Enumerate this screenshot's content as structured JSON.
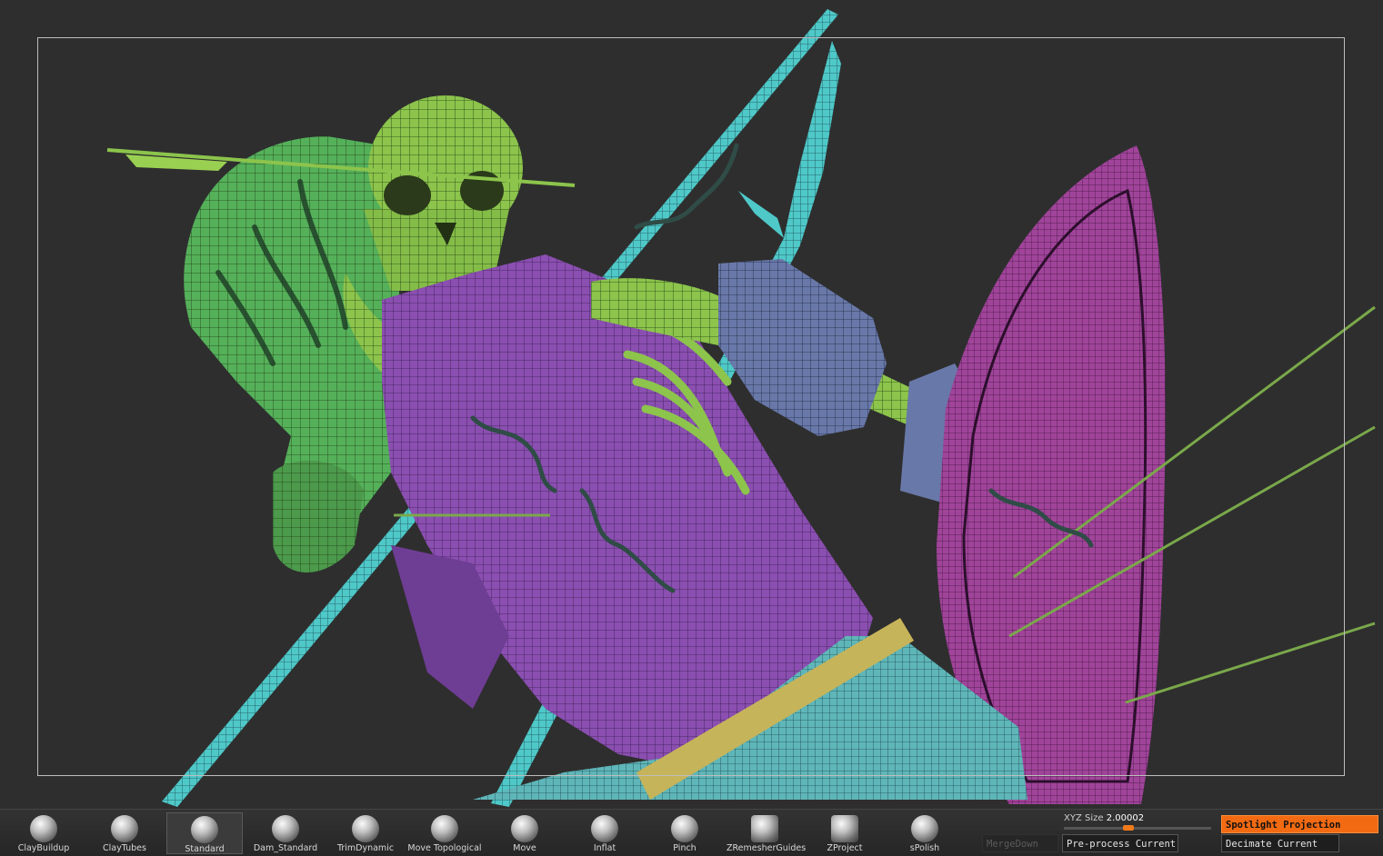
{
  "viewport": {
    "background": "#2e2e2e"
  },
  "colors": {
    "accent": "#f26a12",
    "skull": "#8cc44c",
    "armor": "#8a4fb0",
    "spear": "#4fc8c8",
    "shield": "#a0449a"
  },
  "brushes": [
    {
      "label": "ClayBuildup",
      "icon": "clay-buildup-icon"
    },
    {
      "label": "ClayTubes",
      "icon": "clay-tubes-icon"
    },
    {
      "label": "Standard",
      "icon": "standard-icon",
      "selected": true
    },
    {
      "label": "Dam_Standard",
      "icon": "dam-standard-icon"
    },
    {
      "label": "TrimDynamic",
      "icon": "trim-dynamic-icon"
    },
    {
      "label": "Move  Topological",
      "icon": "move-topological-icon"
    },
    {
      "label": "Move",
      "icon": "move-icon"
    },
    {
      "label": "Inflat",
      "icon": "inflat-icon"
    },
    {
      "label": "Pinch",
      "icon": "pinch-icon"
    },
    {
      "label": "ZRemesherGuides",
      "icon": "zremesher-guides-icon"
    },
    {
      "label": "ZProject",
      "icon": "zproject-icon"
    },
    {
      "label": "sPolish",
      "icon": "spolish-icon"
    }
  ],
  "xyz": {
    "label": "XYZ Size",
    "value": "2.00002",
    "level": 0.43
  },
  "buttons": {
    "merge_down": "MergeDown",
    "preprocess": "Pre-process Current",
    "spotlight": "Spotlight Projection",
    "decimate": "Decimate Current"
  }
}
